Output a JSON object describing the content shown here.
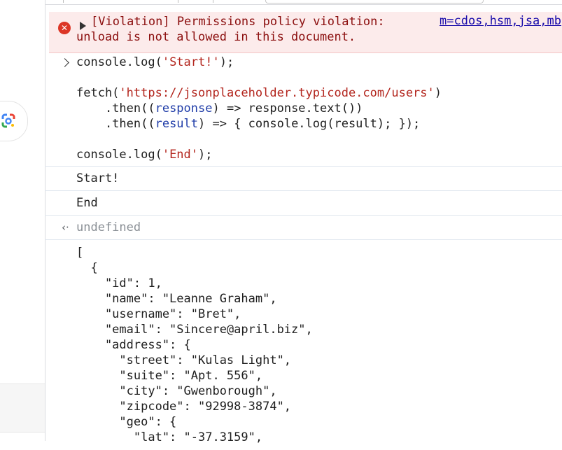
{
  "violation": {
    "message_line1": "[Violation] Permissions policy violation:",
    "message_line2": "unload is not allowed in this document.",
    "source_link": "m=cdos,hsm,jsa,mb"
  },
  "input": {
    "l1_a": "console.log(",
    "l1_b": "'Start!'",
    "l1_c": ");",
    "l2_a": "fetch(",
    "l2_b": "'https://jsonplaceholder.typicode.com/users'",
    "l2_c": ")",
    "l3_a": "    .then((",
    "l3_b": "response",
    "l3_c": ") => response.text())",
    "l4_a": "    .then((",
    "l4_b": "result",
    "l4_c": ") => { console.log(result); });",
    "l5_a": "console.log(",
    "l5_b": "'End'",
    "l5_c": ");"
  },
  "output": {
    "start": "Start!",
    "end": "End",
    "return_value": "undefined"
  },
  "json_output_lines": [
    "[",
    "  {",
    "    \"id\": 1,",
    "    \"name\": \"Leanne Graham\",",
    "    \"username\": \"Bret\",",
    "    \"email\": \"Sincere@april.biz\",",
    "    \"address\": {",
    "      \"street\": \"Kulas Light\",",
    "      \"suite\": \"Apt. 556\",",
    "      \"city\": \"Gwenborough\",",
    "      \"zipcode\": \"92998-3874\",",
    "      \"geo\": {",
    "        \"lat\": \"-37.3159\","
  ],
  "icons": {
    "error": "error-circle-icon",
    "expand": "expand-triangle-icon",
    "prompt": "chevron-right-icon",
    "return": "return-arrow-icon",
    "lens": "google-lens-icon"
  },
  "colors": {
    "error_red": "#dc3626",
    "string_red": "#b3261e",
    "link_blue": "#1a0dab",
    "violation_bg": "#fcebeb"
  }
}
